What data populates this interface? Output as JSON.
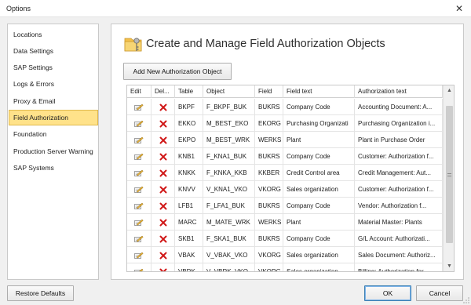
{
  "window": {
    "title": "Options",
    "close_glyph": "✕"
  },
  "nav": {
    "items": [
      {
        "label": "Locations",
        "selected": false
      },
      {
        "label": "Data Settings",
        "selected": false
      },
      {
        "label": "SAP Settings",
        "selected": false
      },
      {
        "label": "Logs & Errors",
        "selected": false
      },
      {
        "label": "Proxy & Email",
        "selected": false
      },
      {
        "label": "Field Authorization",
        "selected": true
      },
      {
        "label": "Foundation",
        "selected": false
      },
      {
        "label": "Production Server Warning",
        "selected": false
      },
      {
        "label": "SAP Systems",
        "selected": false
      }
    ]
  },
  "main": {
    "title": "Create and Manage Field Authorization Objects",
    "add_button": "Add New Authorization Object",
    "icons": {
      "header": "folder-key-icon",
      "edit": "edit-icon",
      "delete": "delete-x-icon"
    },
    "columns": [
      "Edit",
      "Del...",
      "Table",
      "Object",
      "Field",
      "Field text",
      "Authorization text"
    ],
    "rows": [
      {
        "table": "BKPF",
        "object": "F_BKPF_BUK",
        "field": "BUKRS",
        "field_text": "Company Code",
        "auth_text": "Accounting Document: A..."
      },
      {
        "table": "EKKO",
        "object": "M_BEST_EKO",
        "field": "EKORG",
        "field_text": "Purchasing Organizati",
        "auth_text": "Purchasing Organization i..."
      },
      {
        "table": "EKPO",
        "object": "M_BEST_WRK",
        "field": "WERKS",
        "field_text": "Plant",
        "auth_text": "Plant in Purchase Order"
      },
      {
        "table": "KNB1",
        "object": "F_KNA1_BUK",
        "field": "BUKRS",
        "field_text": "Company Code",
        "auth_text": "Customer: Authorization f..."
      },
      {
        "table": "KNKK",
        "object": "F_KNKA_KKB",
        "field": "KKBER",
        "field_text": "Credit Control area",
        "auth_text": "Credit Management: Aut..."
      },
      {
        "table": "KNVV",
        "object": "V_KNA1_VKO",
        "field": "VKORG",
        "field_text": "Sales organization",
        "auth_text": "Customer: Authorization f..."
      },
      {
        "table": "LFB1",
        "object": "F_LFA1_BUK",
        "field": "BUKRS",
        "field_text": "Company Code",
        "auth_text": "Vendor: Authorization f..."
      },
      {
        "table": "MARC",
        "object": "M_MATE_WRK",
        "field": "WERKS",
        "field_text": "Plant",
        "auth_text": "Material Master: Plants"
      },
      {
        "table": "SKB1",
        "object": "F_SKA1_BUK",
        "field": "BUKRS",
        "field_text": "Company Code",
        "auth_text": "G/L Account: Authorizati..."
      },
      {
        "table": "VBAK",
        "object": "V_VBAK_VKO",
        "field": "VKORG",
        "field_text": "Sales organization",
        "auth_text": "Sales Document: Authoriz..."
      },
      {
        "table": "VBRK",
        "object": "V_VBRK_VKO",
        "field": "VKORG",
        "field_text": "Sales organization",
        "auth_text": "Billing: Authorization for..."
      }
    ],
    "scroll_up": "▲",
    "scroll_down": "▼"
  },
  "footer": {
    "restore": "Restore Defaults",
    "ok": "OK",
    "cancel": "Cancel"
  },
  "colors": {
    "selected_bg": "#ffe28a",
    "delete_red": "#d01818",
    "ok_border": "#3c7fb1"
  }
}
